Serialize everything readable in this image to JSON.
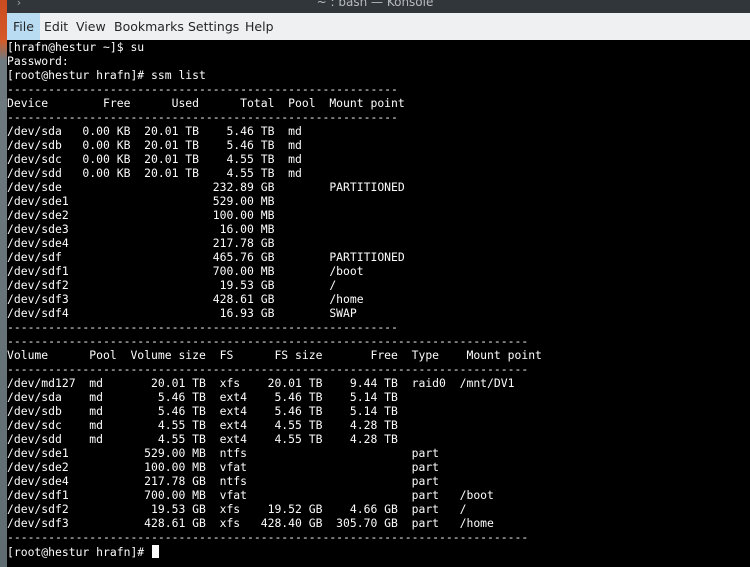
{
  "window": {
    "title": "~ : bash — Konsole"
  },
  "menubar": {
    "items": [
      "File",
      "Edit",
      "View",
      "Bookmarks",
      "Settings",
      "Help"
    ]
  },
  "terminal": {
    "lines": [
      "[hrafn@hestur ~]$ su",
      "Password:",
      "[root@hestur hrafn]# ssm list",
      "---------------------------------------------------------",
      "Device        Free      Used      Total  Pool  Mount point",
      "---------------------------------------------------------",
      "/dev/sda   0.00 KB  20.01 TB    5.46 TB  md",
      "/dev/sdb   0.00 KB  20.01 TB    5.46 TB  md",
      "/dev/sdc   0.00 KB  20.01 TB    4.55 TB  md",
      "/dev/sdd   0.00 KB  20.01 TB    4.55 TB  md",
      "/dev/sde                      232.89 GB        PARTITIONED",
      "/dev/sde1                     529.00 MB",
      "/dev/sde2                     100.00 MB",
      "/dev/sde3                      16.00 MB",
      "/dev/sde4                     217.78 GB",
      "/dev/sdf                      465.76 GB        PARTITIONED",
      "/dev/sdf1                     700.00 MB        /boot",
      "/dev/sdf2                      19.53 GB        /",
      "/dev/sdf3                     428.61 GB        /home",
      "/dev/sdf4                      16.93 GB        SWAP",
      "---------------------------------------------------------",
      "----------------------------------------------------------------------------",
      "Volume      Pool  Volume size  FS      FS size       Free  Type    Mount point",
      "----------------------------------------------------------------------------",
      "/dev/md127  md       20.01 TB  xfs    20.01 TB    9.44 TB  raid0  /mnt/DV1",
      "/dev/sda    md        5.46 TB  ext4    5.46 TB    5.14 TB",
      "/dev/sdb    md        5.46 TB  ext4    5.46 TB    5.14 TB",
      "/dev/sdc    md        4.55 TB  ext4    4.55 TB    4.28 TB",
      "/dev/sdd    md        4.55 TB  ext4    4.55 TB    4.28 TB",
      "/dev/sde1           529.00 MB  ntfs                        part",
      "/dev/sde2           100.00 MB  vfat                        part",
      "/dev/sde4           217.78 GB  ntfs                        part",
      "/dev/sdf1           700.00 MB  vfat                        part   /boot",
      "/dev/sdf2            19.53 GB  xfs    19.52 GB    4.66 GB  part   /",
      "/dev/sdf3           428.61 GB  xfs   428.40 GB  305.70 GB  part   /home",
      "----------------------------------------------------------------------------",
      "[root@hestur hrafn]# "
    ]
  },
  "icons": {
    "app": "konsole-icon",
    "cursor": "text-cursor"
  },
  "colors": {
    "terminal_bg": "#000000",
    "terminal_fg": "#fcfcfc",
    "menubar_bg": "#eff0f1",
    "menu_active": "#b9dcf2",
    "titlebar_bg": "#31363b"
  }
}
